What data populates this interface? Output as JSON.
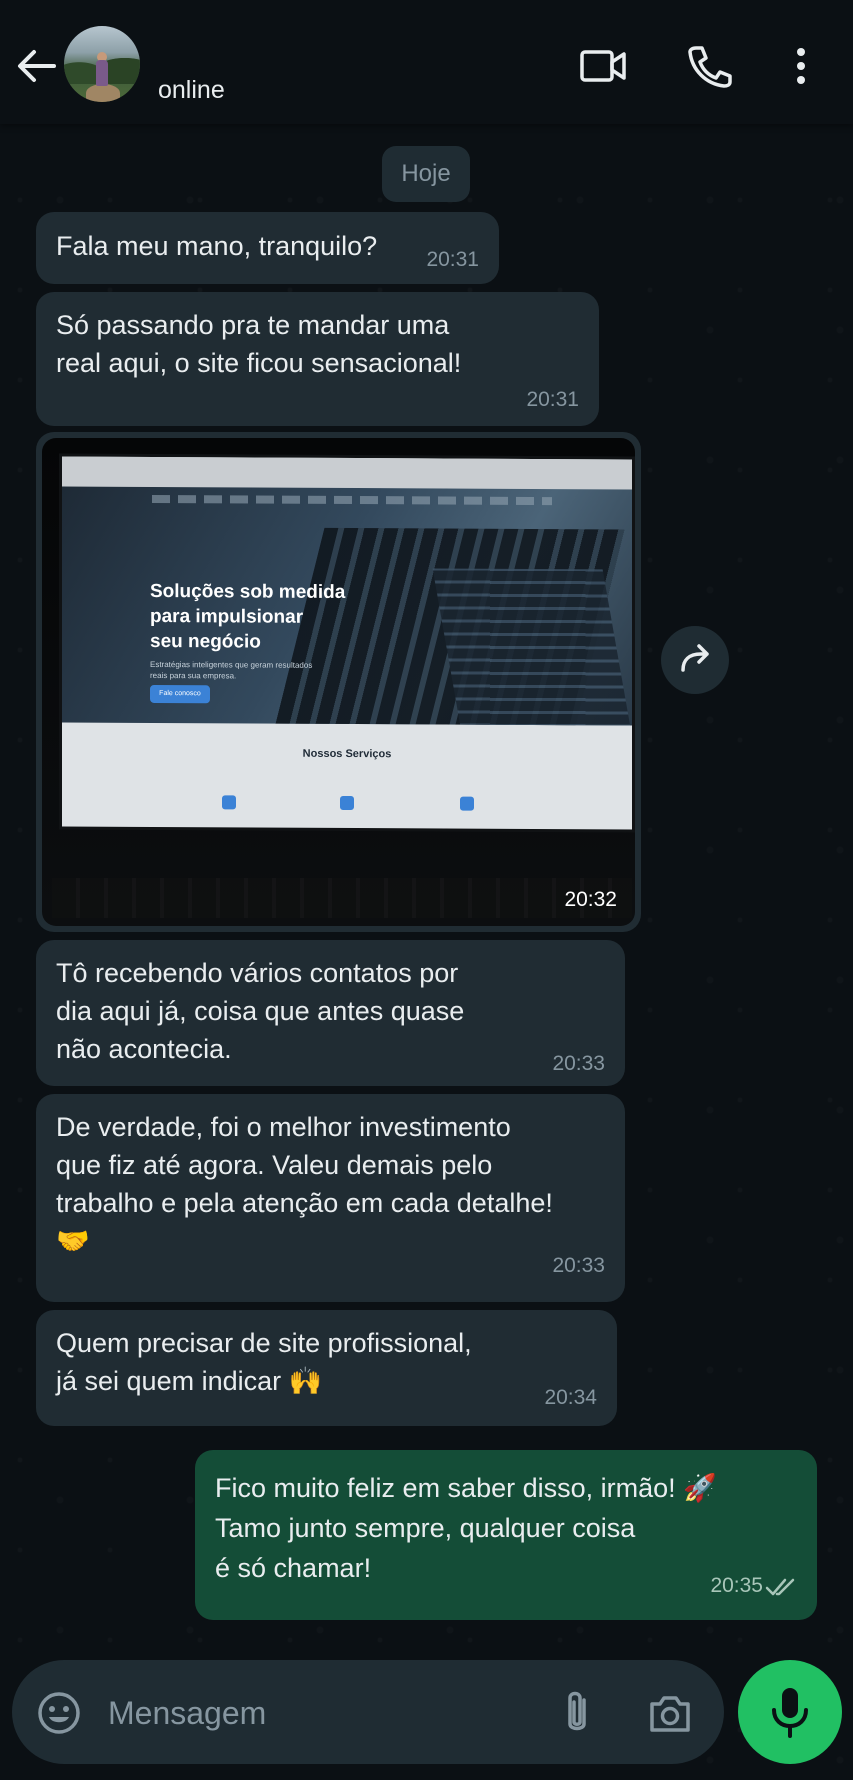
{
  "header": {
    "status": "online"
  },
  "chat": {
    "date_label": "Hoje",
    "messages": [
      {
        "text": "Fala meu mano, tranquilo?",
        "time": "20:31"
      },
      {
        "text": "Só passando pra te mandar uma\nreal aqui, o site ficou sensacional!",
        "time": "20:31"
      },
      {
        "type": "image",
        "time": "20:32",
        "image": {
          "hero_title": "Soluções sob medida\npara impulsionar\nseu negócio",
          "hero_subtitle": "Estratégias inteligentes que geram resultados reais para sua empresa.",
          "hero_button": "Fale conosco",
          "services_title": "Nossos Serviços"
        }
      },
      {
        "text": "Tô recebendo vários contatos por\ndia aqui já, coisa que antes quase\nnão acontecia.",
        "time": "20:33"
      },
      {
        "text": "De verdade, foi o melhor investimento\nque fiz até agora. Valeu demais pelo\ntrabalho e pela atenção em cada detalhe!\n🤝",
        "time": "20:33"
      },
      {
        "text": "Quem precisar de site profissional,\njá sei quem indicar 🙌",
        "time": "20:34"
      },
      {
        "text": "Fico muito feliz em saber disso, irmão! 🚀\nTamo junto sempre, qualquer coisa\né só chamar!",
        "time": "20:35",
        "outgoing": true,
        "read": true
      }
    ]
  },
  "composer": {
    "placeholder": "Mensagem"
  },
  "colors": {
    "background": "#0b1014",
    "incoming_bubble": "#202c33",
    "outgoing_bubble": "#144d37",
    "mic_button": "#21c063"
  },
  "icons": [
    "back-arrow-icon",
    "video-call-icon",
    "phone-icon",
    "more-vert-icon",
    "forward-icon",
    "emoji-icon",
    "attach-icon",
    "camera-icon",
    "mic-icon",
    "double-check-icon"
  ]
}
